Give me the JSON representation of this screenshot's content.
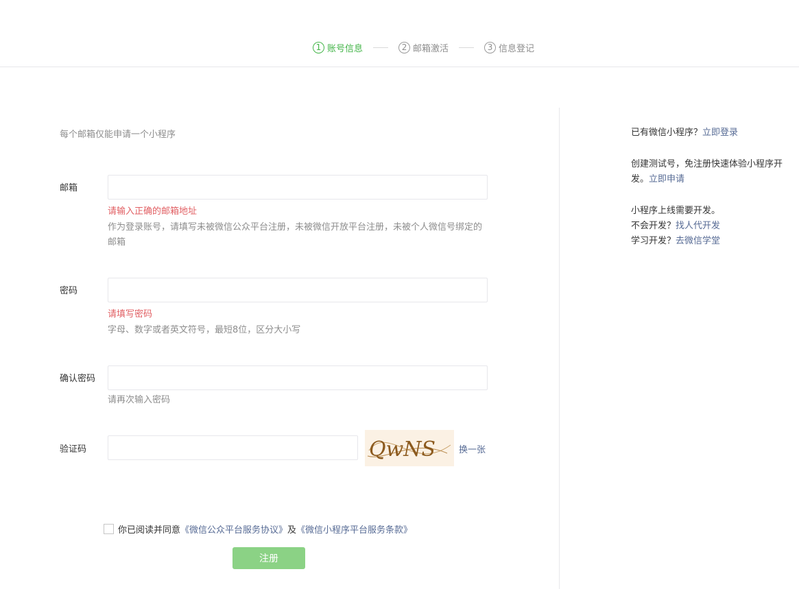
{
  "steps": [
    {
      "num": "1",
      "label": "账号信息"
    },
    {
      "num": "2",
      "label": "邮箱激活"
    },
    {
      "num": "3",
      "label": "信息登记"
    }
  ],
  "form": {
    "tip": "每个邮箱仅能申请一个小程序",
    "email": {
      "label": "邮箱",
      "value": "",
      "error": "请输入正确的邮箱地址",
      "hint": "作为登录账号，请填写未被微信公众平台注册，未被微信开放平台注册，未被个人微信号绑定的邮箱"
    },
    "password": {
      "label": "密码",
      "value": "",
      "error": "请填写密码",
      "hint": "字母、数字或者英文符号，最短8位，区分大小写"
    },
    "confirm": {
      "label": "确认密码",
      "value": "",
      "hint": "请再次输入密码"
    },
    "captcha": {
      "label": "验证码",
      "value": "",
      "image_text": "QwNS",
      "refresh": "换一张"
    },
    "agreement": {
      "prefix": "你已阅读并同意",
      "link1": "《微信公众平台服务协议》",
      "and": "及",
      "link2": "《微信小程序平台服务条款》"
    },
    "submit": "注册"
  },
  "side": {
    "have_text": "已有微信小程序？",
    "login_link": "立即登录",
    "test_text": "创建测试号，免注册快速体验小程序开发。",
    "apply_link": "立即申请",
    "dev_text": "小程序上线需要开发。",
    "no_dev_text": "不会开发？",
    "find_link": "找人代开发",
    "learn_text": "学习开发？",
    "school_link": "去微信学堂"
  },
  "colors": {
    "accent": "#44b549",
    "link": "#576b95",
    "error": "#e15f63",
    "button": "#8bd285"
  }
}
